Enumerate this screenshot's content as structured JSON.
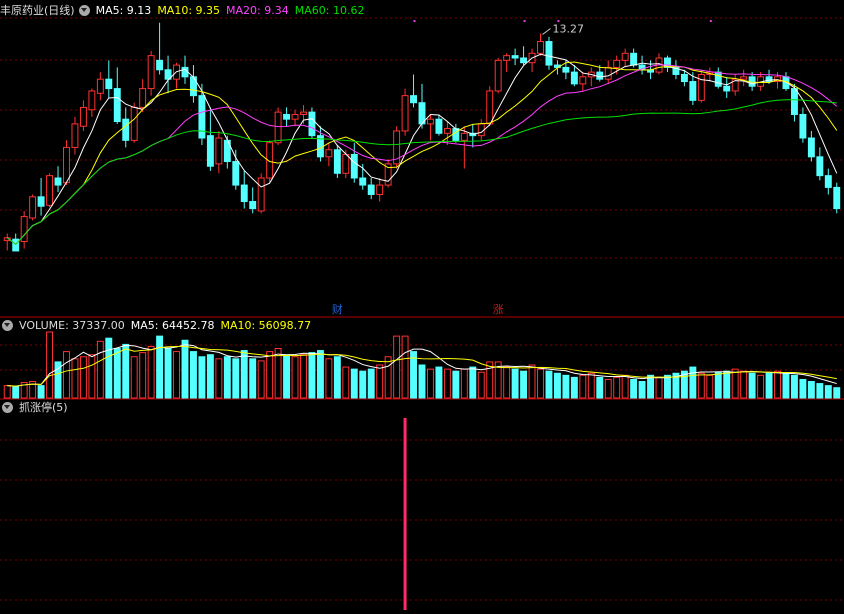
{
  "main": {
    "stock_label": "丰原药业(日线)",
    "ma5_label": "MA5: 9.13",
    "ma10_label": "MA10: 9.35",
    "ma20_label": "MA20: 9.34",
    "ma60_label": "MA60: 10.62",
    "high_marker": "13.27",
    "event_tags": [
      "财",
      "涨"
    ]
  },
  "volume_panel": {
    "volume_label": "VOLUME: 37337.00",
    "ma5_label": "MA5: 64452.78",
    "ma10_label": "MA10: 56098.77"
  },
  "indicator_panel": {
    "title": "抓涨停(5)"
  },
  "colors": {
    "up": "#ff3232",
    "down": "#54ffff",
    "ma5": "#ffffff",
    "ma10": "#ffff00",
    "ma20": "#ff40ff",
    "ma60": "#00e000",
    "grid": "#7a0000",
    "signal": "#ff2b6b"
  },
  "chart_data": {
    "type": "candlestick",
    "price_range": [
      8.5,
      13.6
    ],
    "ohlc": [
      [
        8.87,
        9.02,
        8.66,
        8.93
      ],
      [
        8.9,
        9.02,
        8.72,
        8.65
      ],
      [
        8.85,
        9.5,
        8.7,
        9.38
      ],
      [
        9.35,
        9.85,
        9.3,
        9.8
      ],
      [
        9.8,
        10.2,
        9.4,
        9.6
      ],
      [
        9.62,
        10.3,
        9.58,
        10.25
      ],
      [
        10.2,
        10.45,
        9.9,
        10.05
      ],
      [
        10.1,
        11.0,
        10.05,
        10.85
      ],
      [
        10.85,
        11.5,
        10.7,
        11.35
      ],
      [
        11.3,
        11.85,
        11.2,
        11.7
      ],
      [
        11.65,
        12.1,
        11.5,
        12.05
      ],
      [
        12.0,
        12.45,
        11.85,
        12.3
      ],
      [
        12.3,
        12.7,
        11.9,
        12.1
      ],
      [
        12.1,
        12.55,
        11.35,
        11.4
      ],
      [
        11.45,
        11.7,
        10.85,
        11.0
      ],
      [
        11.0,
        11.8,
        10.95,
        11.7
      ],
      [
        11.7,
        12.3,
        11.6,
        12.1
      ],
      [
        12.1,
        12.9,
        11.95,
        12.8
      ],
      [
        12.7,
        13.5,
        12.4,
        12.5
      ],
      [
        12.5,
        12.8,
        12.0,
        12.3
      ],
      [
        12.3,
        12.65,
        12.1,
        12.6
      ],
      [
        12.55,
        12.8,
        12.2,
        12.35
      ],
      [
        12.35,
        12.6,
        11.8,
        11.95
      ],
      [
        11.95,
        12.2,
        10.9,
        11.05
      ],
      [
        11.1,
        11.7,
        10.35,
        10.45
      ],
      [
        10.5,
        11.2,
        10.3,
        11.05
      ],
      [
        11.0,
        11.1,
        10.4,
        10.55
      ],
      [
        10.55,
        10.8,
        9.95,
        10.05
      ],
      [
        10.05,
        10.35,
        9.55,
        9.7
      ],
      [
        9.7,
        10.0,
        9.45,
        9.55
      ],
      [
        9.5,
        10.3,
        9.45,
        10.2
      ],
      [
        10.2,
        11.0,
        10.1,
        10.95
      ],
      [
        10.95,
        11.7,
        10.9,
        11.6
      ],
      [
        11.55,
        11.7,
        11.3,
        11.45
      ],
      [
        11.45,
        11.65,
        11.3,
        11.55
      ],
      [
        11.55,
        11.75,
        11.35,
        11.6
      ],
      [
        11.6,
        11.7,
        11.05,
        11.1
      ],
      [
        11.1,
        11.3,
        10.55,
        10.65
      ],
      [
        10.65,
        10.95,
        10.45,
        10.8
      ],
      [
        10.8,
        10.9,
        10.2,
        10.3
      ],
      [
        10.3,
        10.8,
        10.2,
        10.7
      ],
      [
        10.7,
        10.95,
        10.1,
        10.2
      ],
      [
        10.2,
        10.5,
        9.95,
        10.05
      ],
      [
        10.05,
        10.2,
        9.75,
        9.85
      ],
      [
        9.85,
        10.2,
        9.7,
        10.05
      ],
      [
        10.05,
        10.6,
        10.0,
        10.5
      ],
      [
        10.5,
        11.3,
        10.4,
        11.2
      ],
      [
        11.2,
        12.1,
        11.1,
        11.95
      ],
      [
        11.95,
        12.4,
        11.7,
        11.8
      ],
      [
        11.8,
        12.2,
        11.25,
        11.35
      ],
      [
        11.35,
        11.55,
        11.0,
        11.45
      ],
      [
        11.45,
        11.55,
        11.1,
        11.15
      ],
      [
        11.15,
        11.4,
        10.9,
        11.25
      ],
      [
        11.25,
        11.35,
        10.95,
        11.0
      ],
      [
        11.0,
        11.3,
        10.4,
        11.15
      ],
      [
        11.15,
        11.35,
        10.85,
        11.1
      ],
      [
        11.1,
        11.45,
        11.0,
        11.35
      ],
      [
        11.35,
        12.15,
        11.3,
        12.05
      ],
      [
        12.05,
        12.75,
        12.0,
        12.7
      ],
      [
        12.7,
        12.85,
        12.45,
        12.8
      ],
      [
        12.8,
        12.95,
        12.6,
        12.75
      ],
      [
        12.75,
        13.0,
        12.6,
        12.65
      ],
      [
        12.65,
        12.95,
        12.45,
        12.85
      ],
      [
        12.85,
        13.27,
        12.8,
        13.1
      ],
      [
        13.1,
        13.2,
        12.5,
        12.6
      ],
      [
        12.6,
        12.7,
        12.4,
        12.55
      ],
      [
        12.55,
        12.7,
        12.3,
        12.45
      ],
      [
        12.45,
        12.6,
        12.15,
        12.2
      ],
      [
        12.2,
        12.45,
        12.05,
        12.35
      ],
      [
        12.35,
        12.55,
        12.15,
        12.45
      ],
      [
        12.45,
        12.6,
        12.25,
        12.3
      ],
      [
        12.3,
        12.7,
        12.2,
        12.55
      ],
      [
        12.55,
        12.8,
        12.4,
        12.7
      ],
      [
        12.7,
        12.95,
        12.55,
        12.85
      ],
      [
        12.85,
        12.95,
        12.55,
        12.6
      ],
      [
        12.6,
        12.8,
        12.4,
        12.5
      ],
      [
        12.5,
        12.7,
        12.3,
        12.45
      ],
      [
        12.45,
        12.85,
        12.4,
        12.75
      ],
      [
        12.75,
        12.8,
        12.45,
        12.55
      ],
      [
        12.55,
        12.7,
        12.3,
        12.4
      ],
      [
        12.4,
        12.5,
        12.15,
        12.25
      ],
      [
        12.25,
        12.45,
        11.75,
        11.85
      ],
      [
        11.85,
        12.5,
        11.8,
        12.4
      ],
      [
        12.4,
        12.55,
        12.25,
        12.45
      ],
      [
        12.45,
        12.55,
        12.1,
        12.15
      ],
      [
        12.15,
        12.35,
        11.9,
        12.05
      ],
      [
        12.05,
        12.4,
        11.95,
        12.3
      ],
      [
        12.3,
        12.5,
        12.15,
        12.35
      ],
      [
        12.35,
        12.45,
        12.05,
        12.15
      ],
      [
        12.15,
        12.45,
        12.05,
        12.35
      ],
      [
        12.35,
        12.5,
        12.2,
        12.25
      ],
      [
        12.25,
        12.45,
        12.1,
        12.35
      ],
      [
        12.35,
        12.45,
        12.05,
        12.1
      ],
      [
        12.1,
        12.2,
        11.4,
        11.55
      ],
      [
        11.55,
        11.7,
        10.95,
        11.05
      ],
      [
        11.05,
        11.2,
        10.55,
        10.65
      ],
      [
        10.65,
        10.85,
        10.15,
        10.25
      ],
      [
        10.25,
        10.4,
        9.85,
        10.0
      ],
      [
        10.0,
        10.1,
        9.45,
        9.55
      ]
    ],
    "volume": [
      12000,
      11000,
      15000,
      16000,
      12000,
      64000,
      35000,
      45000,
      38000,
      40000,
      42000,
      55000,
      58000,
      48000,
      52000,
      40000,
      44000,
      50000,
      60000,
      48000,
      45000,
      56000,
      45000,
      40000,
      42000,
      38000,
      40000,
      38000,
      46000,
      38000,
      36000,
      45000,
      48000,
      42000,
      40000,
      42000,
      44000,
      46000,
      38000,
      40000,
      30000,
      28000,
      26000,
      28000,
      32000,
      40000,
      60000,
      60000,
      45000,
      32000,
      28000,
      30000,
      28000,
      26000,
      28000,
      30000,
      25000,
      35000,
      35000,
      30000,
      28000,
      26000,
      32000,
      28000,
      26000,
      24000,
      22000,
      20000,
      22000,
      24000,
      20000,
      18000,
      20000,
      22000,
      18000,
      16000,
      22000,
      20000,
      22000,
      24000,
      26000,
      30000,
      24000,
      22000,
      25000,
      26000,
      28000,
      26000,
      24000,
      22000,
      24000,
      26000,
      24000,
      22000,
      18000,
      16000,
      14000,
      12000,
      10000
    ],
    "ylabel": "",
    "xlabel": ""
  }
}
